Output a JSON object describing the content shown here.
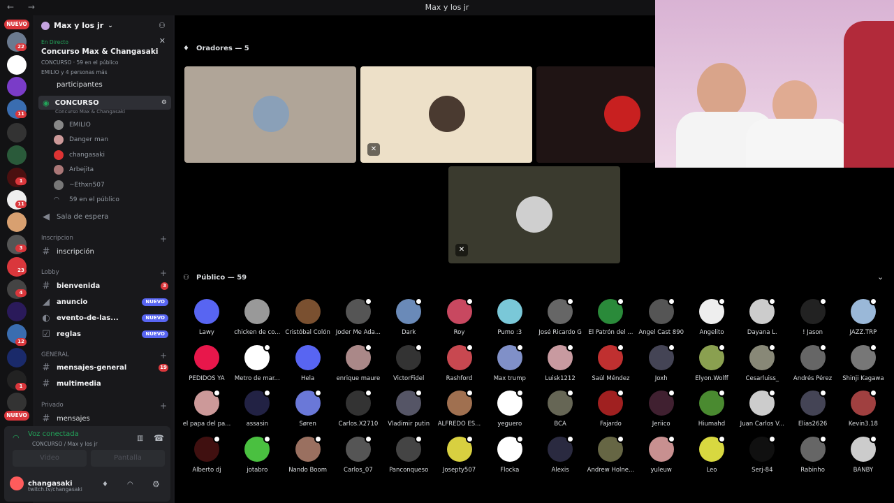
{
  "window": {
    "title": "Max y los jr",
    "nav": "← →"
  },
  "servers": {
    "nuevo_top": "NUEVO",
    "nuevo_bottom": "NUEVO",
    "badges": [
      "22",
      "11",
      "1",
      "11",
      "3",
      "23",
      "4",
      "12",
      "1"
    ]
  },
  "server": {
    "name": "Max y los jr"
  },
  "event": {
    "live": "En Directo",
    "title": "Concurso Max & Changasaki",
    "sub": "CONCURSO · 59 en el público",
    "sub2": "EMILIO y 4 personas más"
  },
  "channels": {
    "participantes": "participantes",
    "concurso": {
      "name": "CONCURSO",
      "subtitle": "Concurso Max & Changasaki"
    },
    "users": [
      "EMILIO",
      "Danger man",
      "changasaki",
      "Arbejita",
      "~Ethxn507"
    ],
    "audience": "59 en el público",
    "sala": "Sala de espera",
    "cat_inscripcion": "Inscripcion",
    "inscripcion": "inscripción",
    "cat_lobby": "Lobby",
    "bienvenida": "bienvenida",
    "bienvenida_badge": "3",
    "anuncio": "anuncio",
    "anuncio_badge": "NUEVO",
    "evento": "evento-de-las...",
    "evento_badge": "NUEVO",
    "reglas": "reglas",
    "reglas_badge": "NUEVO",
    "cat_general": "GENERAL",
    "mensajes_general": "mensajes-general",
    "mg_badge": "19",
    "multimedia": "multimedia",
    "cat_privado": "Privado",
    "mensajes": "mensajes"
  },
  "voice": {
    "status": "Voz conectada",
    "channel": "CONCURSO / Max y los jr",
    "video": "Video",
    "screen": "Pantalla"
  },
  "me": {
    "name": "changasaki",
    "status": "twitch.tv/changasaki"
  },
  "stage": {
    "speakers_label": "Oradores — 5",
    "public_label": "Público — 59"
  },
  "audience": [
    "Lawy",
    "chicken de co...",
    "Cristóbal Colón",
    "Joder Me Ada...",
    "Dark",
    "Roy",
    "Pumo :3",
    "José Ricardo G",
    "El Patrón del ...",
    "Angel Cast 890",
    "Angelito",
    "Dayana L.",
    "! Jason",
    "JAZZ.TRP",
    "PEDIDOS YA",
    "Metro de mar...",
    "Hela",
    "enrique maure",
    "VictorFidel",
    "Rashford",
    "Max trump",
    "Luisk1212",
    "Saúl Méndez",
    "Joxh",
    "Elyon.Wolff",
    "Cesarluiss_",
    "Andrés Pérez",
    "Shinji Kagawa",
    "el papa del pa...",
    "assasin",
    "Søren",
    "Carlos.X2710",
    "Vladimir putin",
    "ALFREDO ES...",
    "yeguero",
    "BCA",
    "Fajardo",
    "Jeriico",
    "Hiumahd",
    "Juan Carlos V...",
    "Elias2626",
    "Kevin3.18",
    "Alberto dj",
    "jotabro",
    "Nando Boom",
    "Carlos_07",
    "Panconqueso",
    "Josepty507",
    "Flocka",
    "Alexis",
    "Andrew Holne...",
    "yuleuw",
    "Leo",
    "Serj-84",
    "Rabinho",
    "BANBY"
  ],
  "colors": {
    "accent": "#5865f2",
    "danger": "#da373c",
    "green": "#23a55a"
  }
}
